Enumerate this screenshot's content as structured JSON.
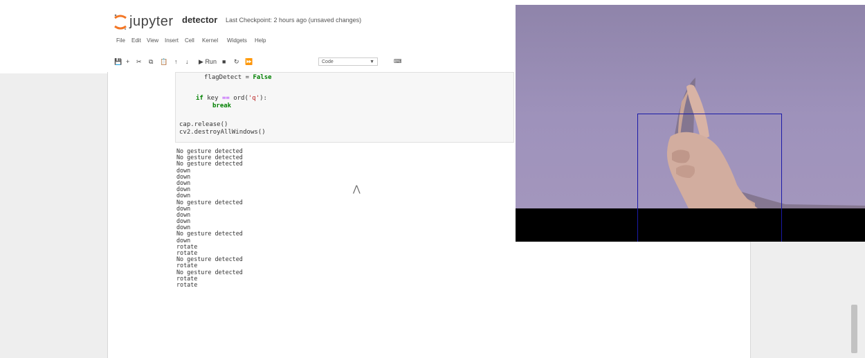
{
  "app": {
    "logo_text": "jupyter",
    "notebook_name": "detector",
    "checkpoint_text": "Last Checkpoint: 2 hours ago (unsaved changes)"
  },
  "menu": [
    "File",
    "Edit",
    "View",
    "Insert",
    "Cell",
    "Kernel",
    "Widgets",
    "Help"
  ],
  "toolbar": {
    "icons": [
      "save-icon",
      "add-cell-icon",
      "cut-icon",
      "copy-icon",
      "paste-icon",
      "move-up-icon",
      "move-down-icon"
    ],
    "run_label": "Run",
    "cell_type": "Code",
    "keyboard_icon": "keyboard-icon"
  },
  "code": {
    "line1_var": "flagDetect",
    "line1_eq": " = ",
    "line1_val": "False",
    "line2_kw": "if",
    "line2_rest_a": " key ",
    "line2_op": "==",
    "line2_rest_b": " ord(",
    "line2_str": "'q'",
    "line2_end": "):",
    "line3_kw": "break",
    "line4": "cap.release()",
    "line5": "cv2.destroyAllWindows()"
  },
  "output": [
    "No gesture detected",
    "No gesture detected",
    "No gesture detected",
    "down",
    "down",
    "down",
    "down",
    "down",
    "No gesture detected",
    "down",
    "down",
    "down",
    "down",
    "No gesture detected",
    "down",
    "rotate",
    "rotate",
    "No gesture detected",
    "rotate",
    "No gesture detected",
    "rotate",
    "rotate"
  ],
  "colors": {
    "roi_box": "#1a1aa8",
    "camera_background": "#9b8fb8"
  }
}
